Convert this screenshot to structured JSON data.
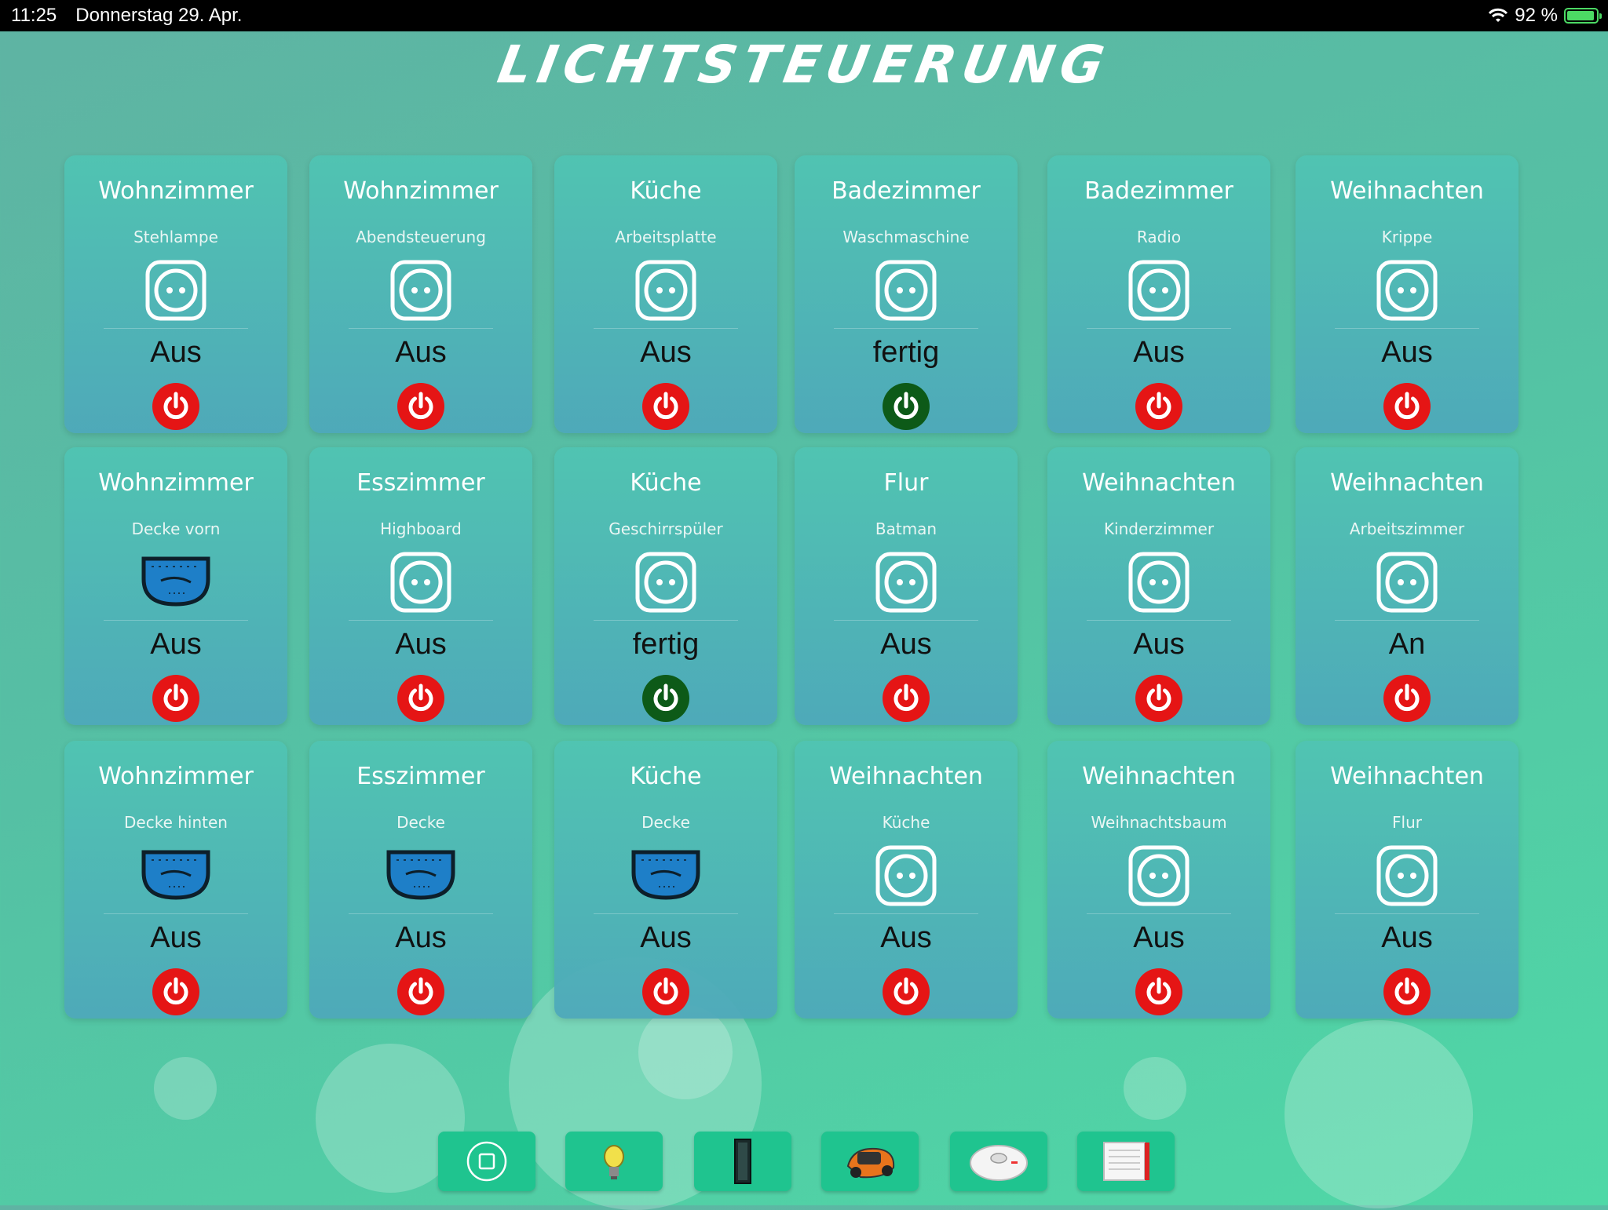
{
  "status_bar": {
    "time": "11:25",
    "date": "Donnerstag 29. Apr.",
    "battery": "92 %"
  },
  "page_title": "LICHTSTEUERUNG",
  "cards": [
    {
      "room": "Wohnzimmer",
      "device": "Stehlampe",
      "icon": "socket-icon",
      "state": "Aus",
      "power_color": "#e51515"
    },
    {
      "room": "Wohnzimmer",
      "device": "Abendsteuerung",
      "icon": "socket-icon",
      "state": "Aus",
      "power_color": "#e51515"
    },
    {
      "room": "Küche",
      "device": "Arbeitsplatte",
      "icon": "socket-icon",
      "state": "Aus",
      "power_color": "#e51515"
    },
    {
      "room": "Badezimmer",
      "device": "Waschmaschine",
      "icon": "socket-icon",
      "state": "fertig",
      "power_color": "#0d5a18"
    },
    {
      "room": "Badezimmer",
      "device": "Radio",
      "icon": "socket-icon",
      "state": "Aus",
      "power_color": "#e51515"
    },
    {
      "room": "Weihnachten",
      "device": "Krippe",
      "icon": "socket-icon",
      "state": "Aus",
      "power_color": "#e51515"
    },
    {
      "room": "Wohnzimmer",
      "device": "Decke vorn",
      "icon": "relay-module-icon",
      "state": "Aus",
      "power_color": "#e51515"
    },
    {
      "room": "Esszimmer",
      "device": "Highboard",
      "icon": "socket-icon",
      "state": "Aus",
      "power_color": "#e51515"
    },
    {
      "room": "Küche",
      "device": "Geschirrspüler",
      "icon": "socket-icon",
      "state": "fertig",
      "power_color": "#0d5a18"
    },
    {
      "room": "Flur",
      "device": "Batman",
      "icon": "socket-icon",
      "state": "Aus",
      "power_color": "#e51515"
    },
    {
      "room": "Weihnachten",
      "device": "Kinderzimmer",
      "icon": "socket-icon",
      "state": "Aus",
      "power_color": "#e51515"
    },
    {
      "room": "Weihnachten",
      "device": "Arbeitszimmer",
      "icon": "socket-icon",
      "state": "An",
      "power_color": "#e51515"
    },
    {
      "room": "Wohnzimmer",
      "device": "Decke hinten",
      "icon": "relay-module-icon",
      "state": "Aus",
      "power_color": "#e51515"
    },
    {
      "room": "Esszimmer",
      "device": "Decke",
      "icon": "relay-module-icon",
      "state": "Aus",
      "power_color": "#e51515"
    },
    {
      "room": "Küche",
      "device": "Decke",
      "icon": "relay-module-icon",
      "state": "Aus",
      "power_color": "#e51515"
    },
    {
      "room": "Weihnachten",
      "device": "Küche",
      "icon": "socket-icon",
      "state": "Aus",
      "power_color": "#e51515"
    },
    {
      "room": "Weihnachten",
      "device": "Weihnachtsbaum",
      "icon": "socket-icon",
      "state": "Aus",
      "power_color": "#e51515"
    },
    {
      "room": "Weihnachten",
      "device": "Flur",
      "icon": "socket-icon",
      "state": "Aus",
      "power_color": "#e51515"
    }
  ],
  "dock": [
    {
      "name": "home-button",
      "icon": "home-square-icon"
    },
    {
      "name": "lights-button",
      "icon": "light-bulb-icon"
    },
    {
      "name": "doors-button",
      "icon": "door-icon"
    },
    {
      "name": "lawnmower-button",
      "icon": "robot-mower-icon"
    },
    {
      "name": "vacuum-button",
      "icon": "robot-vacuum-icon"
    },
    {
      "name": "router-button",
      "icon": "router-icon"
    }
  ]
}
